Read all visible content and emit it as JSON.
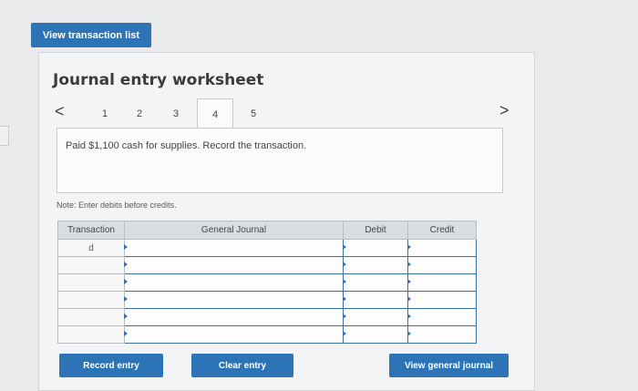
{
  "top": {
    "view_transactions_label": "View transaction list"
  },
  "worksheet": {
    "title": "Journal entry worksheet",
    "prev_glyph": "<",
    "next_glyph": ">",
    "tabs": [
      "1",
      "2",
      "3",
      "4",
      "5"
    ],
    "active_tab": "4",
    "description": "Paid $1,100 cash for supplies. Record the transaction.",
    "note": "Note: Enter debits before credits."
  },
  "table": {
    "headers": [
      "Transaction",
      "General Journal",
      "Debit",
      "Credit"
    ],
    "rows": [
      {
        "transaction": "d",
        "general_journal": "",
        "debit": "",
        "credit": ""
      },
      {
        "transaction": "",
        "general_journal": "",
        "debit": "",
        "credit": ""
      },
      {
        "transaction": "",
        "general_journal": "",
        "debit": "",
        "credit": ""
      },
      {
        "transaction": "",
        "general_journal": "",
        "debit": "",
        "credit": ""
      },
      {
        "transaction": "",
        "general_journal": "",
        "debit": "",
        "credit": ""
      },
      {
        "transaction": "",
        "general_journal": "",
        "debit": "",
        "credit": ""
      }
    ]
  },
  "buttons": {
    "record_entry": "Record entry",
    "clear_entry": "Clear entry",
    "view_general_journal": "View general journal"
  },
  "colors": {
    "accent": "#2c74b5",
    "panel": "#f3f4f5",
    "table_header": "#d9dde2"
  }
}
